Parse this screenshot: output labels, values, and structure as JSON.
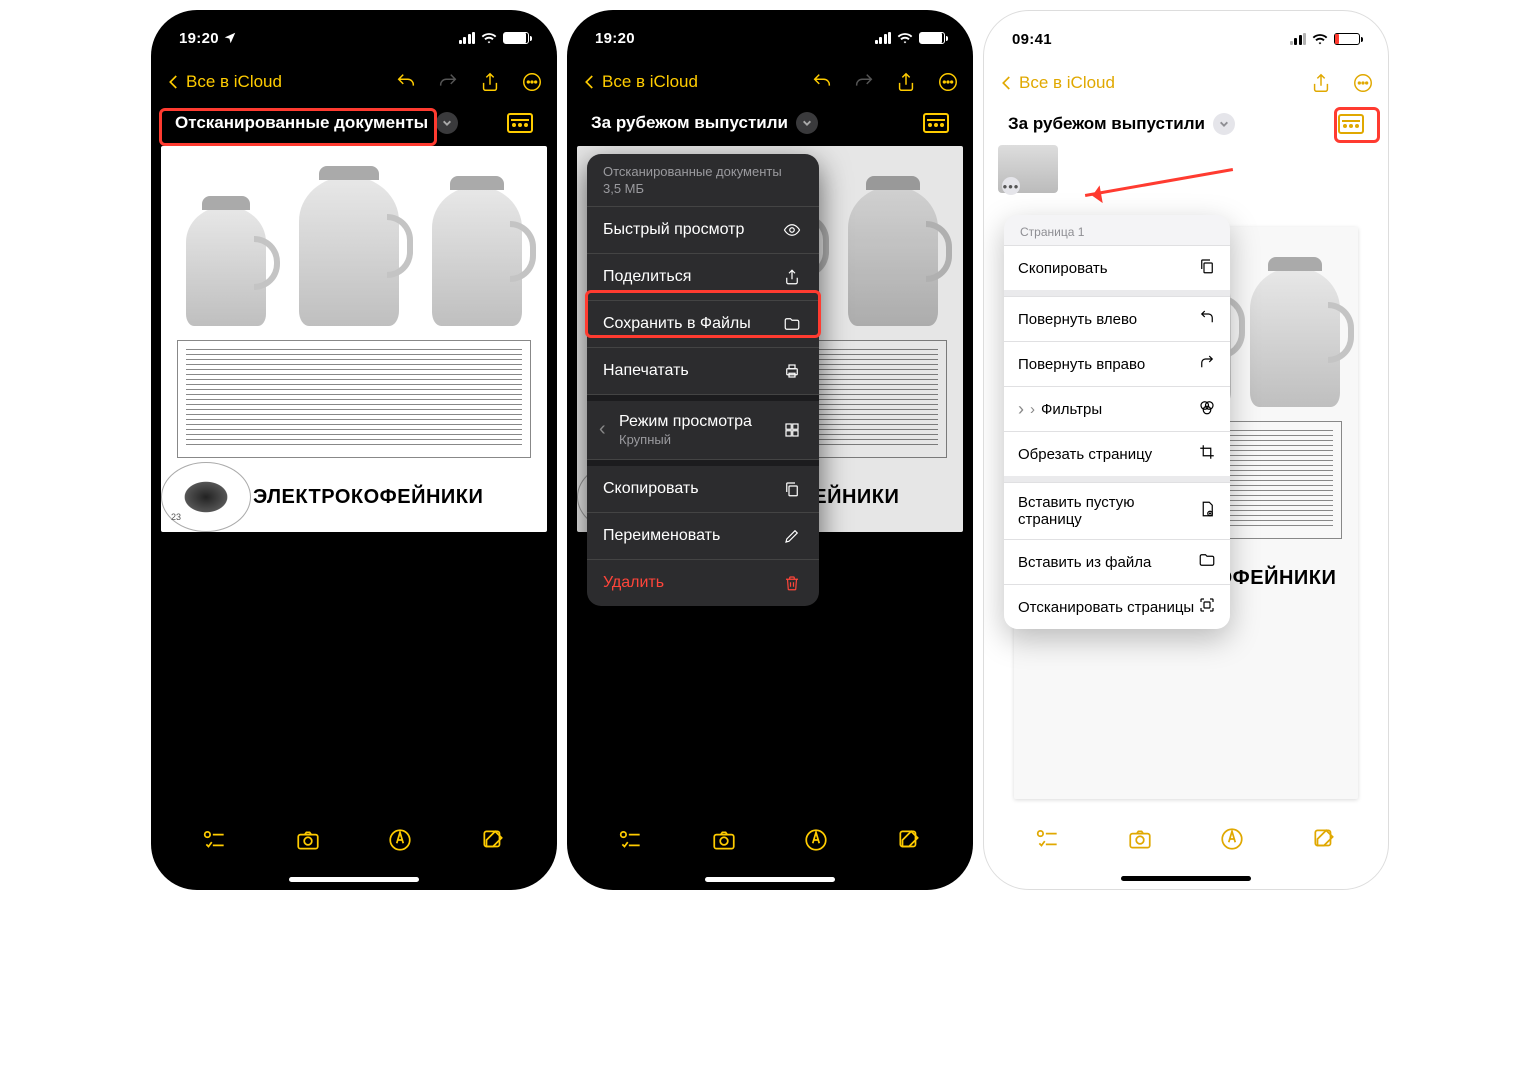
{
  "status": {
    "dark_time": "19:20",
    "light_time": "09:41"
  },
  "nav": {
    "back_label": "Все в iCloud"
  },
  "screen1": {
    "title": "Отсканированные документы"
  },
  "screen2": {
    "title": "За рубежом выпустили",
    "menu": {
      "header_title": "Отсканированные документы",
      "header_size": "3,5 МБ",
      "quick_look": "Быстрый просмотр",
      "share": "Поделиться",
      "save_to_files": "Сохранить в Файлы",
      "print": "Напечатать",
      "view_mode": "Режим просмотра",
      "view_mode_value": "Крупный",
      "copy": "Скопировать",
      "rename": "Переименовать",
      "delete_": "Удалить"
    }
  },
  "screen3": {
    "title": "За рубежом выпустили",
    "menu": {
      "header": "Страница 1",
      "copy": "Скопировать",
      "rotate_left": "Повернуть влево",
      "rotate_right": "Повернуть вправо",
      "filters": "Фильтры",
      "crop_page": "Обрезать страницу",
      "insert_blank": "Вставить пустую страницу",
      "insert_from_file": "Вставить из файла",
      "scan_pages": "Отсканировать страницы"
    }
  },
  "document": {
    "brand": "ЭЛЕКТРОКОФЕЙНИКИ",
    "page_num": "23"
  }
}
